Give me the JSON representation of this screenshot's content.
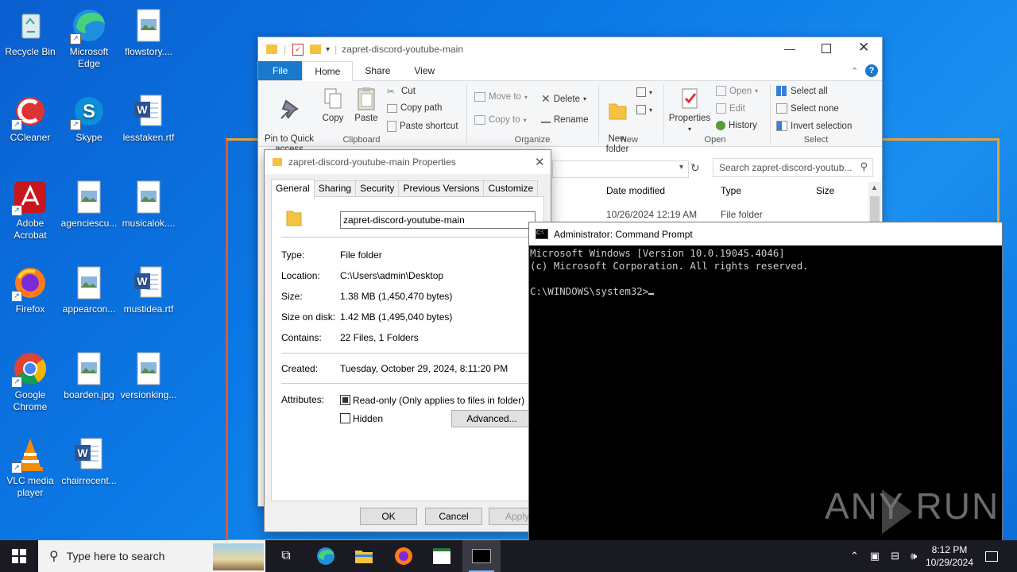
{
  "desktop": {
    "icons": [
      {
        "label": "Recycle Bin",
        "icon": "recycle-bin-icon"
      },
      {
        "label": "Microsoft\nEdge",
        "icon": "edge-icon"
      },
      {
        "label": "flowstory....",
        "icon": "image-file-icon"
      },
      {
        "label": "CCleaner",
        "icon": "ccleaner-icon"
      },
      {
        "label": "Skype",
        "icon": "skype-icon"
      },
      {
        "label": "lesstaken.rtf",
        "icon": "word-doc-icon"
      },
      {
        "label": "Adobe\nAcrobat",
        "icon": "acrobat-icon"
      },
      {
        "label": "agenciescu...",
        "icon": "image-file-icon"
      },
      {
        "label": "musicalok....",
        "icon": "image-file-icon"
      },
      {
        "label": "Firefox",
        "icon": "firefox-icon"
      },
      {
        "label": "appearcon...",
        "icon": "image-file-icon"
      },
      {
        "label": "mustidea.rtf",
        "icon": "word-doc-icon"
      },
      {
        "label": "Google\nChrome",
        "icon": "chrome-icon"
      },
      {
        "label": "boarden.jpg",
        "icon": "image-file-icon"
      },
      {
        "label": "versionking...",
        "icon": "image-file-icon"
      },
      {
        "label": "VLC media\nplayer",
        "icon": "vlc-icon"
      },
      {
        "label": "chairrecent...",
        "icon": "word-doc-icon"
      }
    ]
  },
  "explorer": {
    "title": "zapret-discord-youtube-main",
    "tabs": [
      "File",
      "Home",
      "Share",
      "View"
    ],
    "ribbon": {
      "pin": "Pin to Quick\naccess",
      "copy": "Copy",
      "paste": "Paste",
      "cut": "Cut",
      "copy_path": "Copy path",
      "paste_shortcut": "Paste shortcut",
      "move_to": "Move to",
      "copy_to": "Copy to",
      "delete": "Delete",
      "rename": "Rename",
      "new_folder": "New\nfolder",
      "properties": "Properties",
      "open": "Open",
      "edit": "Edit",
      "history": "History",
      "select_all": "Select all",
      "select_none": "Select none",
      "invert_selection": "Invert selection",
      "groups": [
        "Clipboard",
        "Organize",
        "New",
        "Open",
        "Select"
      ]
    },
    "search_placeholder": "Search zapret-discord-youtub...",
    "columns": [
      "Date modified",
      "Type",
      "Size"
    ],
    "row": {
      "date": "10/26/2024 12:19 AM",
      "type": "File folder"
    }
  },
  "properties": {
    "title": "zapret-discord-youtube-main Properties",
    "tabs": [
      "General",
      "Sharing",
      "Security",
      "Previous Versions",
      "Customize"
    ],
    "name": "zapret-discord-youtube-main",
    "fields": [
      {
        "label": "Type:",
        "value": "File folder"
      },
      {
        "label": "Location:",
        "value": "C:\\Users\\admin\\Desktop"
      },
      {
        "label": "Size:",
        "value": "1.38 MB (1,450,470 bytes)"
      },
      {
        "label": "Size on disk:",
        "value": "1.42 MB (1,495,040 bytes)"
      },
      {
        "label": "Contains:",
        "value": "22 Files, 1 Folders"
      }
    ],
    "created_label": "Created:",
    "created_value": "Tuesday, October 29, 2024, 8:11:20 PM",
    "attributes_label": "Attributes:",
    "readonly": "Read-only (Only applies to files in folder)",
    "hidden": "Hidden",
    "advanced": "Advanced...",
    "ok": "OK",
    "cancel": "Cancel",
    "apply": "Apply"
  },
  "cmd": {
    "title": "Administrator: Command Prompt",
    "line1": "Microsoft Windows [Version 10.0.19045.4046]",
    "line2": "(c) Microsoft Corporation. All rights reserved.",
    "prompt": "C:\\WINDOWS\\system32>"
  },
  "watermark": "ANY RUN",
  "taskbar": {
    "search_placeholder": "Type here to search",
    "time": "8:12 PM",
    "date": "10/29/2024"
  }
}
